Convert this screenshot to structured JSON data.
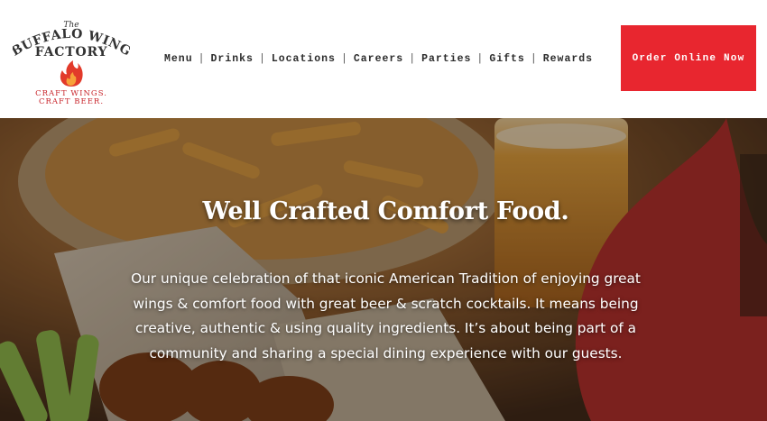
{
  "brand": {
    "logo_top": "The",
    "logo_line1": "BUFFALO WING",
    "logo_line2": "FACTORY",
    "tagline_line1": "CRAFT WINGS.",
    "tagline_line2": "CRAFT BEER.",
    "accent_color": "#e8262f"
  },
  "nav": {
    "items": [
      "Menu",
      "Drinks",
      "Locations",
      "Careers",
      "Parties",
      "Gifts",
      "Rewards"
    ],
    "separator": "|"
  },
  "cta": {
    "order_label": "Order Online Now"
  },
  "hero": {
    "title": "Well Crafted Comfort Food.",
    "body": "Our unique celebration of that iconic American Tradition of enjoying great wings & comfort food with great beer & scratch cocktails. It means being creative, authentic & using quality ingredients. It’s about being part of a community and sharing a special dining experience with our guests."
  }
}
